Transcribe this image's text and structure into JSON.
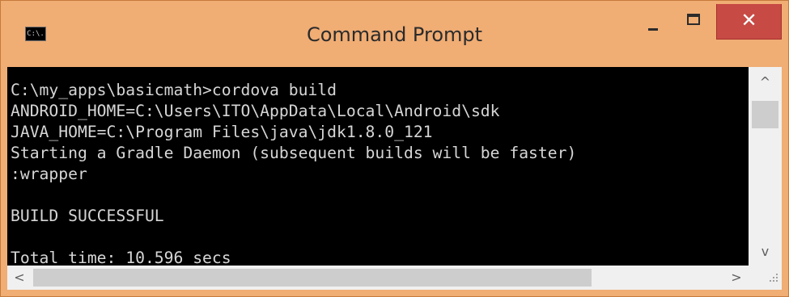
{
  "window": {
    "title": "Command Prompt",
    "icon_label": "C:\\.",
    "icon_name": "command-prompt-icon",
    "title_bar_color": "#f0ad74",
    "close_button_color": "#c74a44"
  },
  "controls": {
    "minimize_icon": "minimize-icon",
    "maximize_icon": "maximize-icon",
    "close_icon": "close-icon",
    "close_glyph": "✕"
  },
  "console": {
    "background": "#000000",
    "foreground": "#d6d6d6",
    "lines": [
      "C:\\my_apps\\basicmath>cordova build",
      "ANDROID_HOME=C:\\Users\\ITO\\AppData\\Local\\Android\\sdk",
      "JAVA_HOME=C:\\Program Files\\java\\jdk1.8.0_121",
      "Starting a Gradle Daemon (subsequent builds will be faster)",
      ":wrapper",
      "",
      "BUILD SUCCESSFUL",
      "",
      "Total time: 10.596 secs"
    ]
  },
  "scrollbars": {
    "up_glyph": "^",
    "down_glyph": "v",
    "left_glyph": "<",
    "right_glyph": ">"
  }
}
